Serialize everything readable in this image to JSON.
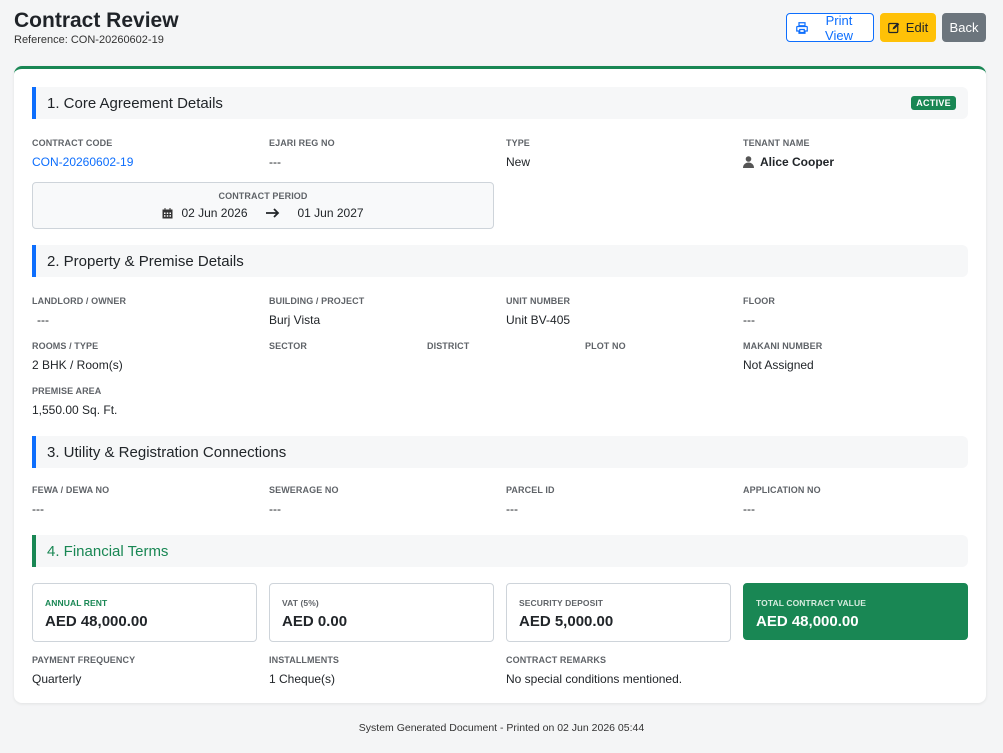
{
  "header": {
    "title": "Contract Review",
    "reference": "Reference: CON-20260602-19"
  },
  "actions": {
    "print_label": "Print View",
    "edit_label": "Edit",
    "back_label": "Back"
  },
  "colors": {
    "primary": "#0d6efd",
    "success": "#198754",
    "warning": "#ffc107",
    "secondary": "#6c757d"
  },
  "core": {
    "title": "1. Core Agreement Details",
    "status_badge": "ACTIVE",
    "contract_code": {
      "label": "CONTRACT CODE",
      "value": "CON-20260602-19"
    },
    "ejari_reg_no": {
      "label": "EJARI REG NO",
      "value": "---"
    },
    "type": {
      "label": "TYPE",
      "value": "New"
    },
    "tenant_name": {
      "label": "TENANT NAME",
      "value": "Alice Cooper"
    },
    "contract_period": {
      "label": "CONTRACT PERIOD",
      "start": "02 Jun 2026",
      "end": "01 Jun 2027"
    }
  },
  "property": {
    "title": "2. Property & Premise Details",
    "landlord": {
      "label": "LANDLORD / OWNER",
      "value": "---"
    },
    "building": {
      "label": "BUILDING / PROJECT",
      "value": "Burj Vista"
    },
    "unit_number": {
      "label": "UNIT NUMBER",
      "value": "Unit BV-405"
    },
    "floor": {
      "label": "FLOOR",
      "value": "---"
    },
    "rooms": {
      "label": "ROOMS / TYPE",
      "value": "2 BHK / Room(s)"
    },
    "sector": {
      "label": "SECTOR",
      "value": ""
    },
    "district": {
      "label": "DISTRICT",
      "value": ""
    },
    "plot_no": {
      "label": "PLOT NO",
      "value": ""
    },
    "makani": {
      "label": "MAKANI NUMBER",
      "value": "Not Assigned"
    },
    "premise_area": {
      "label": "PREMISE AREA",
      "value": "1,550.00 Sq. Ft."
    }
  },
  "utility": {
    "title": "3. Utility & Registration Connections",
    "fewa": {
      "label": "FEWA / DEWA NO",
      "value": "---"
    },
    "sewerage": {
      "label": "SEWERAGE NO",
      "value": "---"
    },
    "parcel": {
      "label": "PARCEL ID",
      "value": "---"
    },
    "application": {
      "label": "APPLICATION NO",
      "value": "---"
    }
  },
  "financial": {
    "title": "4. Financial Terms",
    "annual_rent": {
      "label": "ANNUAL RENT",
      "value": "AED 48,000.00"
    },
    "vat": {
      "label": "VAT (5%)",
      "value": "AED 0.00"
    },
    "security_deposit": {
      "label": "SECURITY DEPOSIT",
      "value": "AED 5,000.00"
    },
    "total": {
      "label": "TOTAL CONTRACT VALUE",
      "value": "AED 48,000.00"
    },
    "payment_frequency": {
      "label": "PAYMENT FREQUENCY",
      "value": "Quarterly"
    },
    "installments": {
      "label": "INSTALLMENTS",
      "value": "1 Cheque(s)"
    },
    "remarks": {
      "label": "CONTRACT REMARKS",
      "value": "No special conditions mentioned."
    }
  },
  "footer": {
    "text": "System Generated Document - Printed on 02 Jun 2026 05:44"
  }
}
